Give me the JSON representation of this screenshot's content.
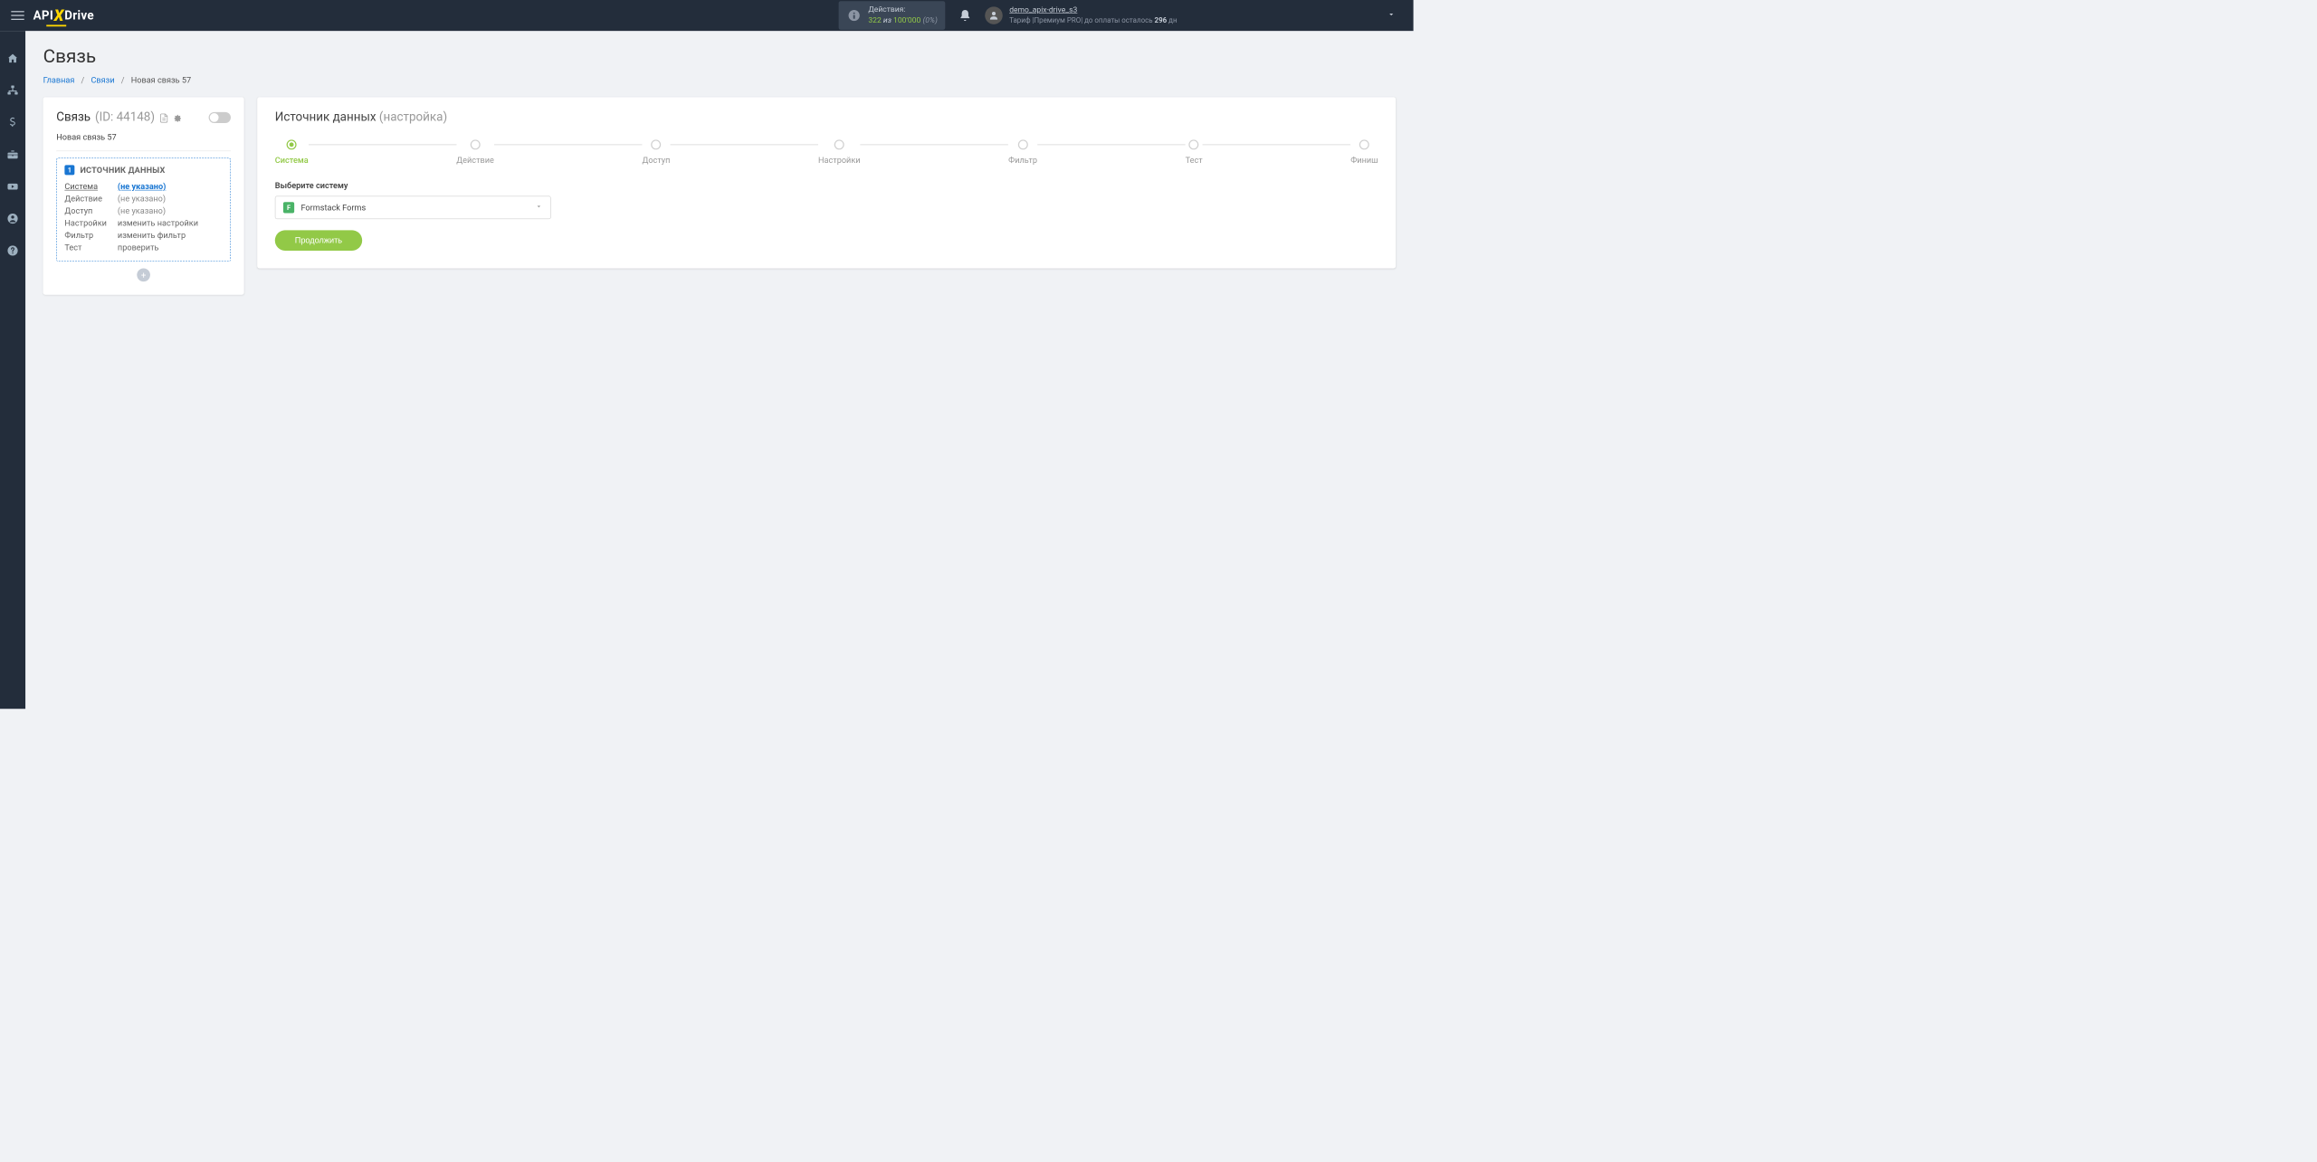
{
  "header": {
    "logo_api": "API",
    "logo_x": "X",
    "logo_drive": "Drive",
    "actions": {
      "label": "Действия:",
      "count": "322",
      "of": "из",
      "total": "100'000",
      "pct": "(0%)"
    },
    "user": {
      "name": "demo_apix-drive_s3",
      "tariff_prefix": "Тариф |Премиум PRO| до оплаты осталось ",
      "tariff_days": "296",
      "tariff_suffix": " дн"
    }
  },
  "page": {
    "title": "Связь"
  },
  "breadcrumbs": {
    "home": "Главная",
    "connections": "Связи",
    "current": "Новая связь 57"
  },
  "leftCard": {
    "title": "Связь",
    "id": "(ID: 44148)",
    "subtitle": "Новая связь 57",
    "source": {
      "badge": "1",
      "title": "ИСТОЧНИК ДАННЫХ",
      "rows": {
        "system_label": "Система",
        "system_value": "(не указано)",
        "action_label": "Действие",
        "action_value": "(не указано)",
        "access_label": "Доступ",
        "access_value": "(не указано)",
        "settings_label": "Настройки",
        "settings_value": "изменить настройки",
        "filter_label": "Фильтр",
        "filter_value": "изменить фильтр",
        "test_label": "Тест",
        "test_value": "проверить"
      }
    }
  },
  "rightCard": {
    "title": "Источник данных",
    "title_sub": "(настройка)",
    "steps": {
      "s1": "Система",
      "s2": "Действие",
      "s3": "Доступ",
      "s4": "Настройки",
      "s5": "Фильтр",
      "s6": "Тест",
      "s7": "Финиш"
    },
    "form": {
      "select_label": "Выберите систему",
      "selected_value": "Formstack Forms",
      "continue": "Продолжить"
    }
  }
}
